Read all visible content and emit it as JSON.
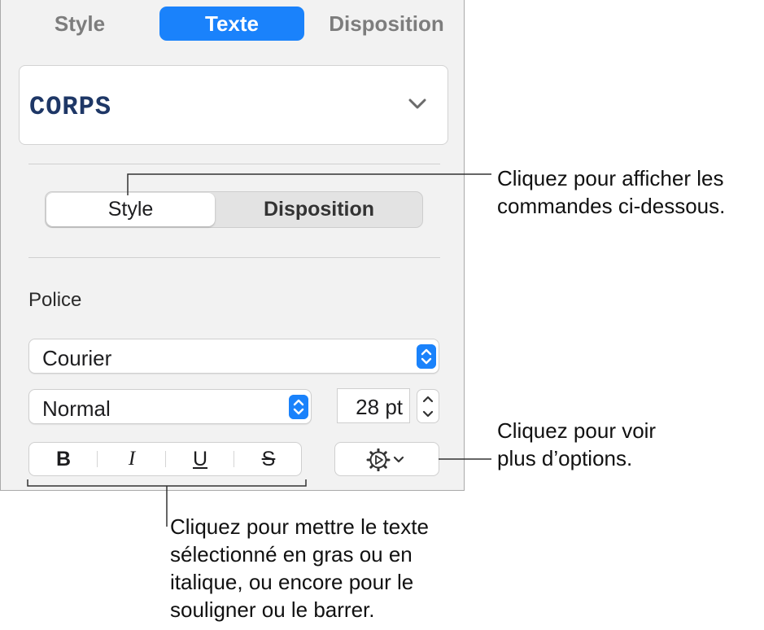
{
  "tabs": [
    {
      "label": "Style"
    },
    {
      "label": "Texte"
    },
    {
      "label": "Disposition"
    }
  ],
  "paragraph_style": {
    "name": "CORPS"
  },
  "segmented": {
    "style_label": "Style",
    "layout_label": "Disposition"
  },
  "font": {
    "section_label": "Police",
    "family": "Courier",
    "typeface": "Normal",
    "size": "28 pt"
  },
  "format_buttons": {
    "bold": "B",
    "italic": "I",
    "underline": "U",
    "strike": "S"
  },
  "callouts": {
    "segment_line1": "Cliquez pour afficher les",
    "segment_line2": "commandes ci-dessous.",
    "options_line1": "Cliquez pour voir",
    "options_line2": "plus d’options.",
    "format_line1": "Cliquez pour mettre le texte",
    "format_line2": "sélectionné en gras ou en",
    "format_line3": "italique, ou encore pour le",
    "format_line4": "souligner ou le barrer."
  },
  "colors": {
    "accent": "#1a82fb",
    "style_text": "#1e3766",
    "panel_bg": "#f2f2f2"
  }
}
